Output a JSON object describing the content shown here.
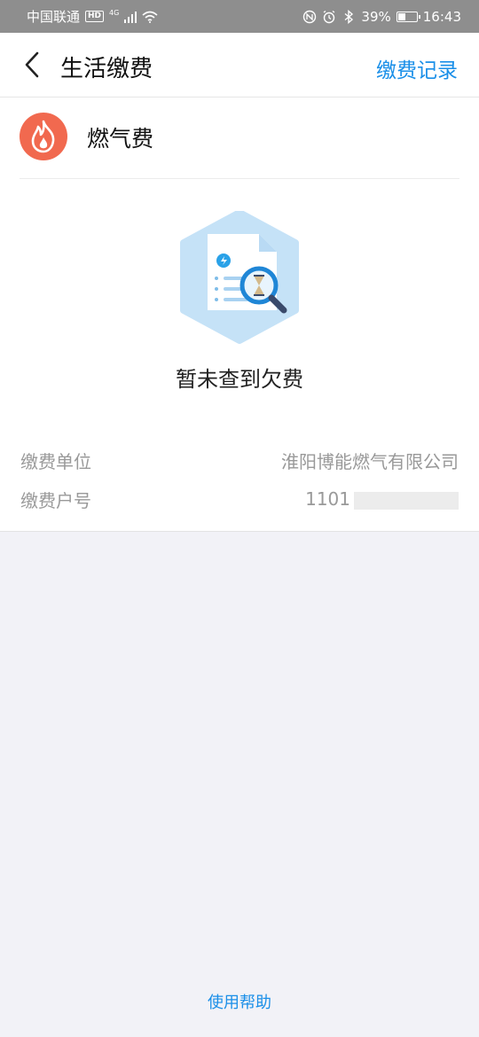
{
  "status_bar": {
    "carrier": "中国联通",
    "hd": "HD",
    "network": "4G",
    "battery_percent": "39%",
    "battery_level": 0.39,
    "time": "16:43"
  },
  "nav": {
    "title": "生活缴费",
    "record_link": "缴费记录",
    "back_icon": "chevron-left-icon"
  },
  "biller": {
    "name": "燃气费",
    "icon": "flame-icon",
    "icon_color": "#f1694f"
  },
  "result": {
    "illustration": "document-search-icon",
    "message": "暂未查到欠费"
  },
  "info": {
    "unit_label": "缴费单位",
    "unit_value": "淮阳博能燃气有限公司",
    "account_label": "缴费户号",
    "account_value_visible": "1101"
  },
  "footer": {
    "help_link": "使用帮助"
  },
  "colors": {
    "accent": "#1a8fe8",
    "status_bar_bg": "#8e8e8e",
    "page_bg": "#f2f2f7"
  }
}
